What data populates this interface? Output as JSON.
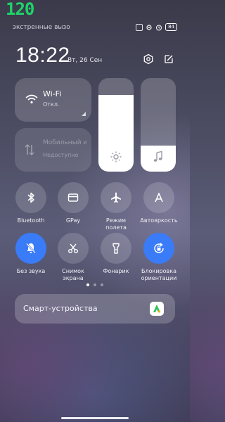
{
  "overlay": {
    "fps_counter": "120"
  },
  "status_bar": {
    "text": "экстренные вызовы",
    "battery": "84"
  },
  "header": {
    "time": "18:22",
    "date": "Вт, 26 Сен"
  },
  "tiles": {
    "wifi": {
      "title": "Wi-Fi",
      "status": "Откл."
    },
    "mobile_data": {
      "title": "Мобильный интернет",
      "status": "Недоступно"
    }
  },
  "sliders": {
    "brightness": {
      "level_percent": 82
    },
    "volume": {
      "level_percent": 28
    }
  },
  "quick_toggles": [
    {
      "label": "Bluetooth",
      "icon": "bluetooth-icon",
      "active": false
    },
    {
      "label": "GPay",
      "icon": "card-icon",
      "active": false
    },
    {
      "label": "Режим полета",
      "icon": "airplane-icon",
      "active": false
    },
    {
      "label": "Автояркость",
      "icon": "auto-brightness-icon",
      "active": false
    },
    {
      "label": "Без звука",
      "icon": "bell-off-icon",
      "active": true
    },
    {
      "label": "Снимок экрана",
      "icon": "scissors-icon",
      "active": false
    },
    {
      "label": "Фонарик",
      "icon": "flashlight-icon",
      "active": false
    },
    {
      "label": "Блокировка ориентации",
      "icon": "rotation-lock-icon",
      "active": true
    }
  ],
  "pager": {
    "current_page": 1,
    "total_pages": 3
  },
  "smart_devices": {
    "label": "Смарт-устройства"
  },
  "colors": {
    "accent": "#3a7bf7",
    "fps_green": "#1fd36a"
  }
}
